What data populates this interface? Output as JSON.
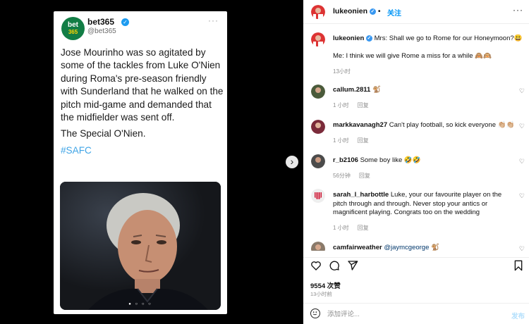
{
  "tweet": {
    "avatar_text_top": "bet",
    "avatar_text_bottom": "365",
    "name": "bet365",
    "handle": "@bet365",
    "paragraph1": "Jose Mourinho was so agitated by some of the tackles from Luke O'Nien during Roma's pre-season friendly with Sunderland that he walked on the pitch mid-game and demanded that the midfielder was sent off.",
    "paragraph2": "The Special O'Nien.",
    "hashtag": "#SAFC"
  },
  "post_header": {
    "username": "lukeonien",
    "follow_label": "关注"
  },
  "caption": {
    "username": "lukeonien",
    "line1": "Mrs: Shall we go to Rome for our Honeymoon?😃",
    "line2": "Me: I think we will give Rome a miss for a while 🙈🙉",
    "time": "13小时"
  },
  "comments": [
    {
      "username": "callum.2811",
      "text": "🐒",
      "time": "1 小时",
      "reply": "回复"
    },
    {
      "username": "markkavanagh27",
      "text": "Can't play football, so kick everyone 👏🏼👏🏼",
      "time": "1 小时",
      "reply": "回复"
    },
    {
      "username": "r_b2106",
      "text": "Some boy like 🤣🤣",
      "time": "56分钟",
      "reply": "回复"
    },
    {
      "username": "sarah_l_harbottle",
      "text": "Luke, your our favourite player on the pitch through and through. Never stop your antics or magnificent playing. Congrats too on the wedding",
      "time": "1 小时",
      "reply": "回复"
    },
    {
      "username": "camfairweather",
      "text": "@jaymcgeorge 🐒",
      "time": "",
      "reply": ""
    }
  ],
  "likes": "9554 次赞",
  "post_time": "13小时前",
  "comment_input": {
    "placeholder": "添加评论...",
    "post_label": "发布"
  },
  "colors": {
    "accent": "#0095f6",
    "tweet_hashtag": "#3fa4e6",
    "bet365_green": "#127d45"
  }
}
